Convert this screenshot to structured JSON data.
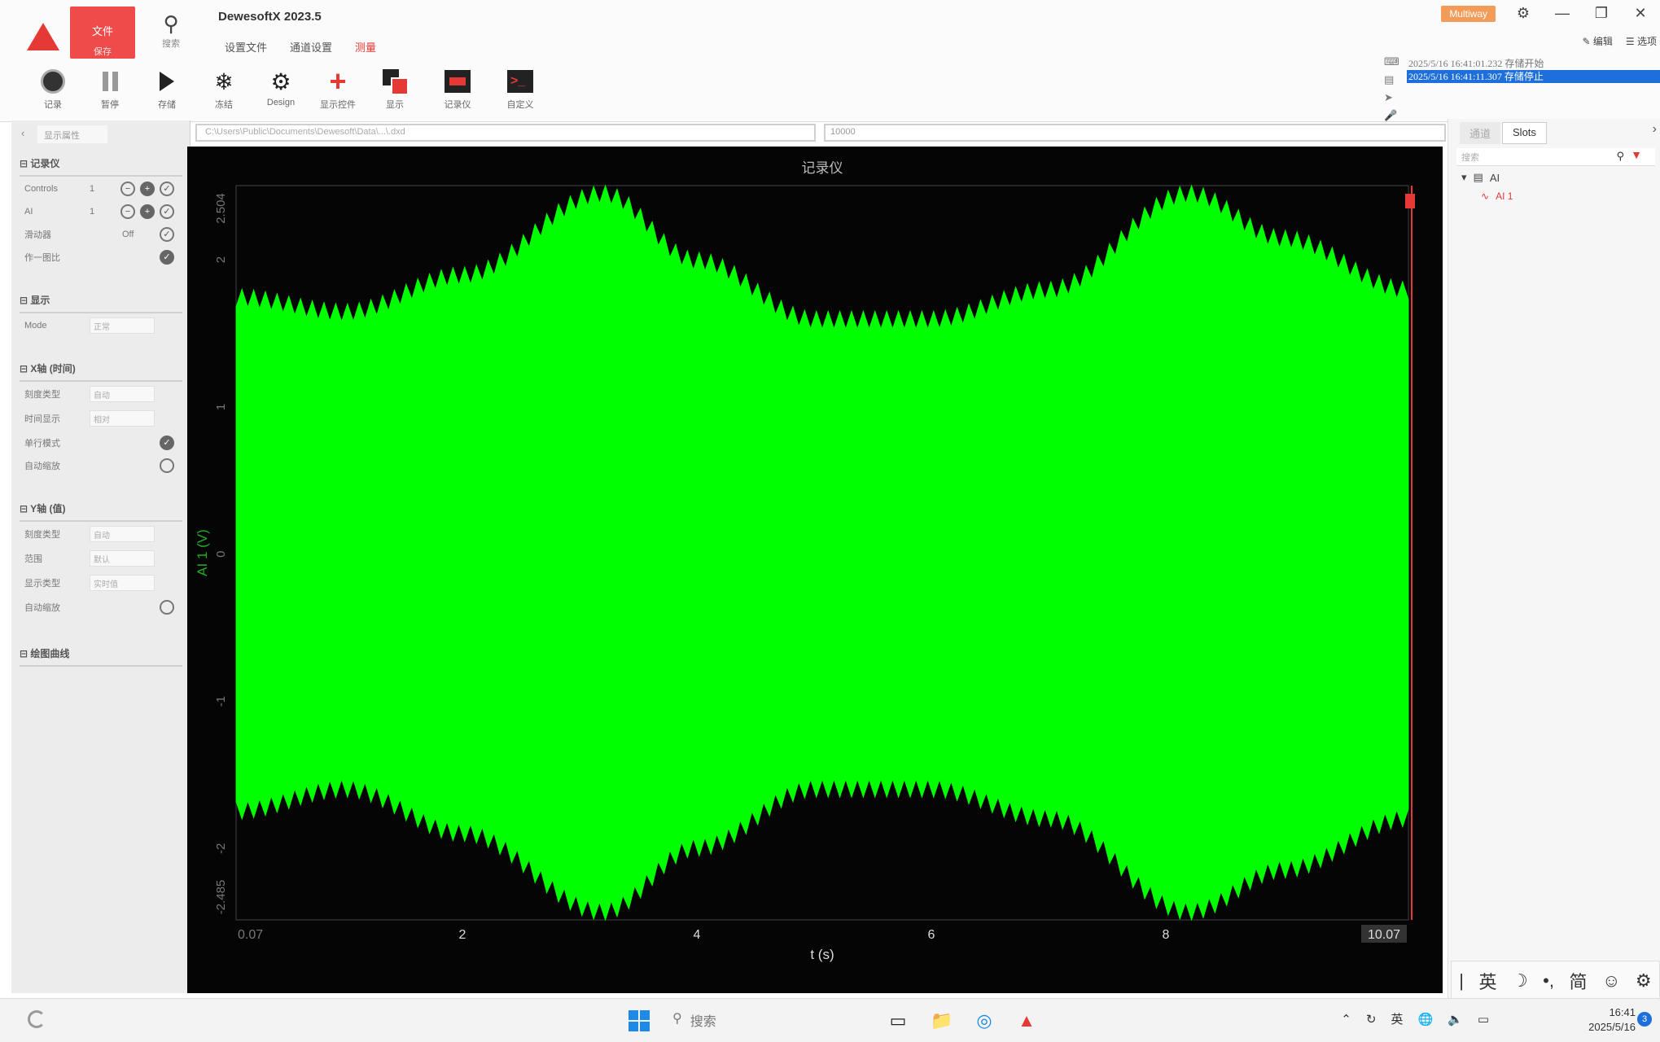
{
  "app": {
    "title": "DewesoftX 2023.5",
    "file_label": "文件",
    "file_sub": "保存",
    "search_label": "搜索",
    "menu_tabs": [
      "设置文件",
      "通道设置",
      "测量"
    ],
    "license_badge": "Multiway",
    "top_right_links": [
      "编辑",
      "选项"
    ]
  },
  "toolbar": [
    {
      "icon": "record-icon",
      "label": "记录"
    },
    {
      "icon": "pause-icon",
      "label": "暂停"
    },
    {
      "icon": "play-icon",
      "label": "存储"
    },
    {
      "icon": "freeze-icon",
      "label": "冻结"
    },
    {
      "icon": "gear-icon",
      "label": "Design"
    },
    {
      "icon": "add-display-icon",
      "label": "显示控件"
    },
    {
      "icon": "display-icon",
      "label": "显示"
    },
    {
      "icon": "recorder-icon",
      "label": "记录仪"
    },
    {
      "icon": "terminal-icon",
      "label": "自定义"
    }
  ],
  "log": {
    "lines": [
      "2025/5/16 16:41:01.232 存储开始",
      "2025/5/16 16:41:11.307 存储停止"
    ],
    "selected_index": 1
  },
  "left_panel": {
    "tab_label": "显示属性",
    "sections": [
      {
        "title": "记录仪",
        "rows": [
          "Controls",
          "AI",
          "滑动器",
          "作一图比"
        ]
      },
      {
        "title": "显示",
        "rows": [
          "Mode"
        ]
      },
      {
        "title": "X轴 (时间)",
        "rows": [
          "刻度类型",
          "时间显示",
          "单行模式",
          "自动缩放"
        ]
      },
      {
        "title": "Y轴 (值)",
        "rows": [
          "刻度类型",
          "范围",
          "显示类型",
          "自动缩放"
        ]
      },
      {
        "title": "绘图曲线",
        "rows": []
      }
    ],
    "values": {
      "controls_num": "1",
      "ai_num": "1",
      "slider_state": "Off",
      "mode": "正常",
      "x_scale_type": "自动",
      "x_time_display": "相对",
      "y_scale_type": "自动",
      "y_range": "默认",
      "y_display_type": "实时值"
    }
  },
  "path_bar": "C:\\Users\\Public\\Documents\\Dewesoft\\Data\\...\\.dxd",
  "sample_bar": "10000",
  "chart_data": {
    "type": "line",
    "title": "记录仪",
    "xlabel": "t (s)",
    "ylabel": "AI 1 (V)",
    "xlim": [
      0.07,
      10.07
    ],
    "ylim": [
      -2.485,
      2.504
    ],
    "x_ticks": [
      "0.07",
      "2",
      "4",
      "6",
      "8",
      "10.07"
    ],
    "y_ticks": [
      "2.504",
      "2",
      "1",
      "0",
      "-1",
      "-2",
      "-2.485"
    ],
    "series": [
      {
        "name": "AI 1",
        "color": "#00ff00",
        "kind": "amplitude-modulated oscillation",
        "x": [
          0.07,
          1.0,
          2.0,
          3.2,
          4.0,
          5.0,
          6.0,
          7.0,
          8.2,
          9.0,
          10.07
        ],
        "envelope_max": [
          1.8,
          1.7,
          1.95,
          2.504,
          2.05,
          1.65,
          1.65,
          1.85,
          2.504,
          2.2,
          1.85
        ],
        "envelope_min": [
          -1.8,
          -1.65,
          -1.95,
          -2.485,
          -2.05,
          -1.65,
          -1.65,
          -1.85,
          -2.485,
          -2.2,
          -1.85
        ]
      }
    ],
    "grid": false,
    "legend": "none"
  },
  "right_panel": {
    "tabs": [
      "通道",
      "Slots"
    ],
    "active_tab": 1,
    "search_placeholder": "搜索",
    "tree": {
      "group": "AI",
      "channel": "AI 1"
    }
  },
  "ime": [
    "英",
    "简"
  ],
  "taskbar": {
    "search_placeholder": "搜索",
    "tray_lang": "英",
    "time": "16:41",
    "date": "2025/5/16",
    "notifications": "3"
  }
}
